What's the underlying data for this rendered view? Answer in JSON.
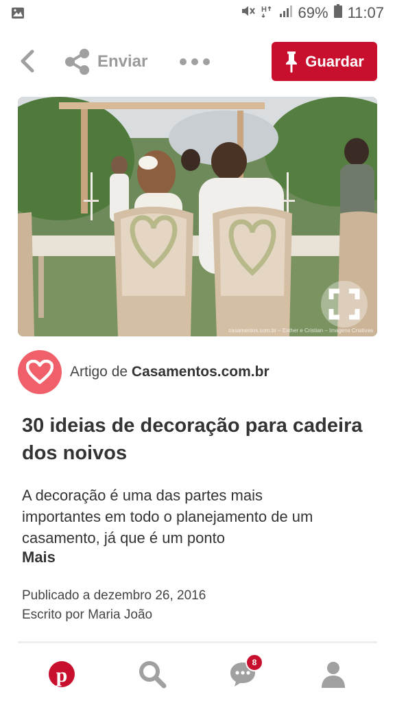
{
  "status_bar": {
    "battery": "69%",
    "time": "11:07",
    "icons": [
      "image-icon",
      "mute-icon",
      "signal-h-icon",
      "signal-bars-icon",
      "battery-icon"
    ]
  },
  "action_bar": {
    "share_label": "Enviar",
    "save_label": "Guardar",
    "icons": [
      "back-chevron-icon",
      "share-icon",
      "more-dots-icon",
      "pin-icon"
    ]
  },
  "image": {
    "watermark": "casamentos.com.br – Esther e Cristian – Imagens Criativas",
    "icon": "zoom-crop-icon"
  },
  "source": {
    "prefix": "Artigo de",
    "name": "Casamentos.com.br",
    "icon": "heart-logo-icon"
  },
  "pin": {
    "title": "30 ideias de decoração para cadeira dos noivos",
    "description": "A decoração é uma das partes mais importantes em todo o planejamento de um casamento, já que é um ponto",
    "more": "Mais",
    "published": "Publicado a dezembro 26, 2016",
    "author": "Escrito por Maria João"
  },
  "bottom_nav": {
    "items": [
      "pinterest-logo-icon",
      "search-icon",
      "chat-icon",
      "profile-icon"
    ],
    "chat_badge": "8"
  },
  "colors": {
    "brand_red": "#c8102e",
    "source_pink": "#f0606a",
    "muted_gray": "#9a9a9a"
  }
}
